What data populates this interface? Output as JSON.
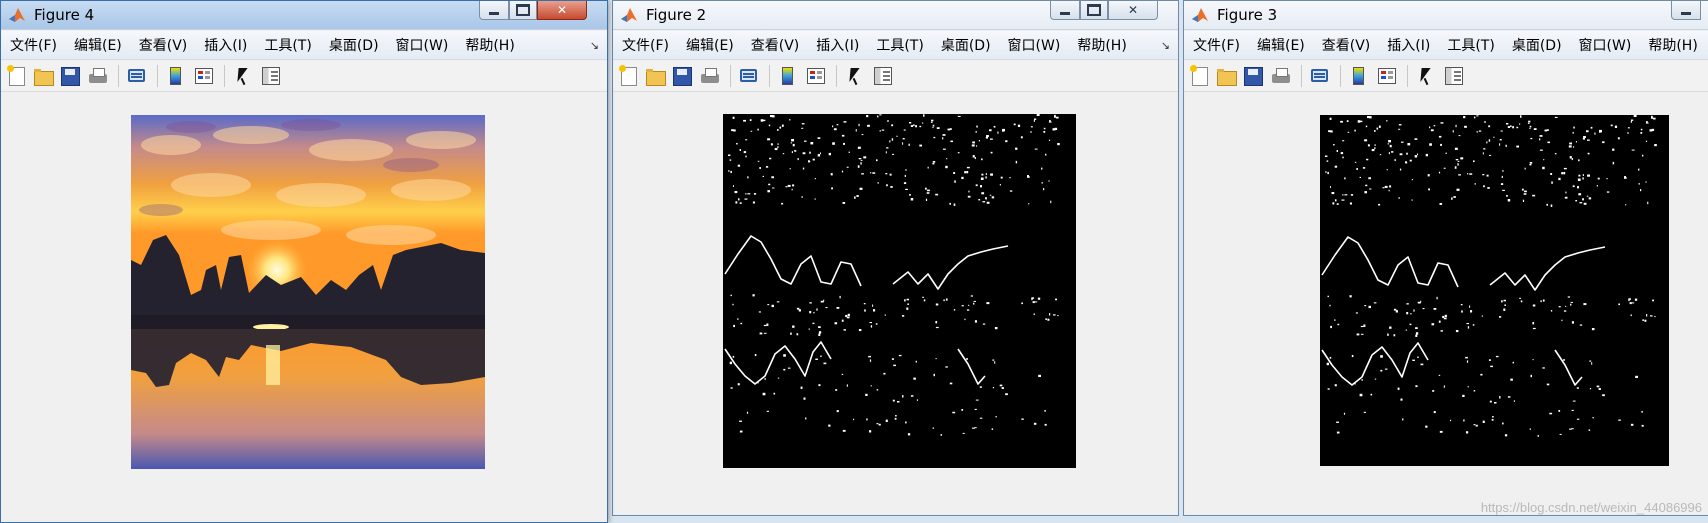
{
  "menu_labels": [
    "文件(F)",
    "编辑(E)",
    "查看(V)",
    "插入(I)",
    "工具(T)",
    "桌面(D)",
    "窗口(W)",
    "帮助(H)"
  ],
  "toolbar_icons": [
    "new-figure-icon",
    "open-file-icon",
    "save-figure-icon",
    "print-figure-icon",
    "link-plot-icon",
    "insert-colorbar-icon",
    "insert-legend-icon",
    "edit-plot-arrow-icon",
    "property-inspector-icon"
  ],
  "windows": {
    "figure4": {
      "title": "Figure 4",
      "image": "color landscape photo: sunset over karst hills with reflection in river"
    },
    "figure2": {
      "title": "Figure 2",
      "image": "binary edge-detection result, white edges on black"
    },
    "figure3": {
      "title": "Figure 3",
      "image": "binary edge-detection result, white edges on black"
    }
  },
  "watermark": "https://blog.csdn.net/weixin_44086996",
  "colors": {
    "titlebar_active": "#a9c6e8",
    "close_active": "#c74a30",
    "window_bg": "#f0f0f0"
  }
}
